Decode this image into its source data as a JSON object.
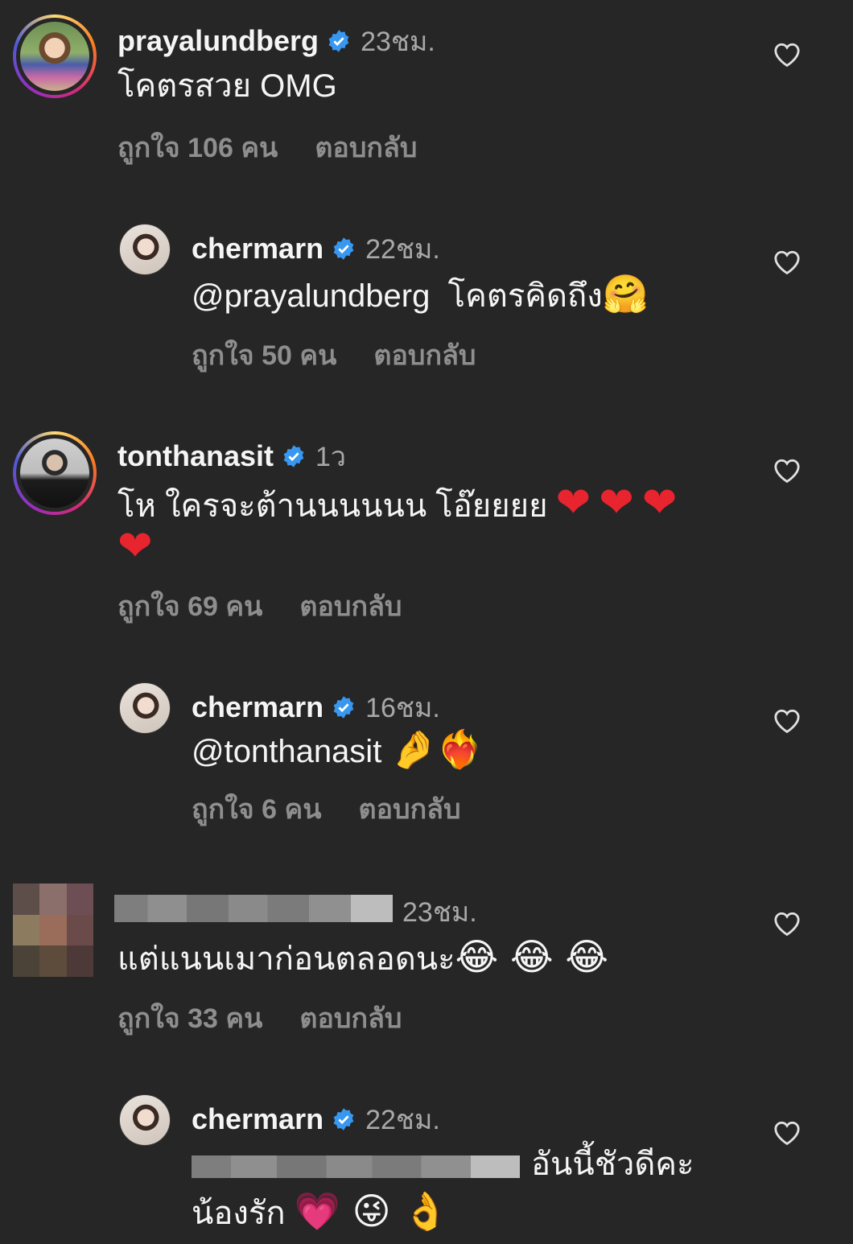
{
  "labels": {
    "reply": "ตอบกลับ"
  },
  "colors": {
    "background": "#262626",
    "text": "#f5f5f5",
    "muted": "#8e8e8e",
    "verified": "#3897f0",
    "heart_emoji": "#e8242f"
  },
  "comments": [
    {
      "username": "prayalundberg",
      "verified": true,
      "time": "23ชม.",
      "text": "โคตรสวย OMG",
      "likes": "ถูกใจ 106 คน"
    },
    {
      "username": "chermarn",
      "verified": true,
      "time": "22ชม.",
      "mention": "@prayalundberg",
      "text": "โคตรคิดถึง",
      "emoji": "🤗",
      "likes": "ถูกใจ 50 คน"
    },
    {
      "username": "tonthanasit",
      "verified": true,
      "time": "1ว",
      "text": "โห ใครจะต้านนนนนน โอ๊ยยยย",
      "emoji": "❤",
      "likes": "ถูกใจ 69 คน"
    },
    {
      "username": "chermarn",
      "verified": true,
      "time": "16ชม.",
      "mention": "@tonthanasit",
      "emoji": "🤌❤️‍🔥",
      "likes": "ถูกใจ 6 คน"
    },
    {
      "username": "",
      "verified": false,
      "time": "23ชม.",
      "text": "แต่แนนเมาก่อนตลอดนะ",
      "emoji": "😂 😂 😂",
      "likes": "ถูกใจ 33 คน"
    },
    {
      "username": "chermarn",
      "verified": true,
      "time": "22ชม.",
      "text": "อันนี้ชัวดีคะ",
      "text2": "น้องรัก",
      "emoji": "💗 😜 👌"
    }
  ]
}
